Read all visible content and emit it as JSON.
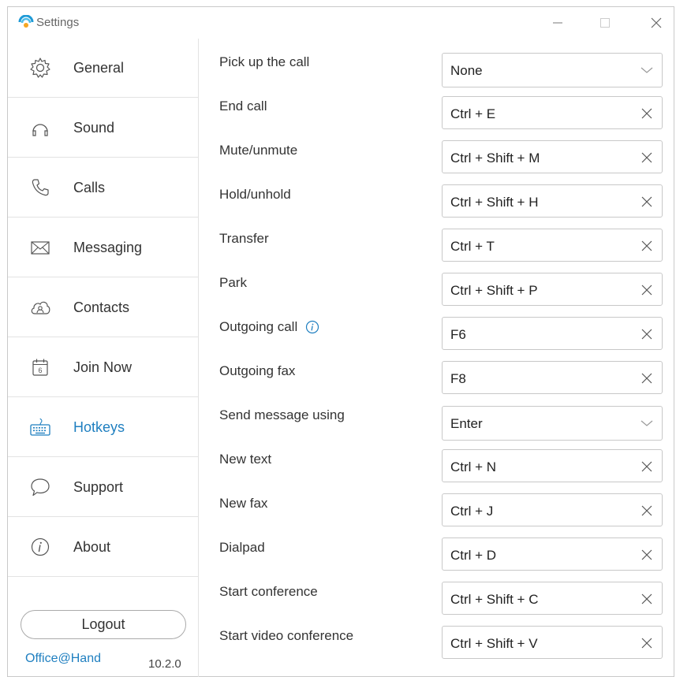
{
  "window": {
    "title": "Settings",
    "logo_icon": "office-at-hand-logo",
    "controls": {
      "minimize": "—",
      "maximize": "□",
      "close": "✕"
    }
  },
  "sidebar": {
    "items": [
      {
        "label": "General",
        "icon": "gear-icon",
        "active": false
      },
      {
        "label": "Sound",
        "icon": "headphones-icon",
        "active": false
      },
      {
        "label": "Calls",
        "icon": "phone-icon",
        "active": false
      },
      {
        "label": "Messaging",
        "icon": "envelope-icon",
        "active": false
      },
      {
        "label": "Contacts",
        "icon": "cloud-contacts-icon",
        "active": false
      },
      {
        "label": "Join Now",
        "icon": "calendar-icon",
        "active": false
      },
      {
        "label": "Hotkeys",
        "icon": "keyboard-icon",
        "active": true
      },
      {
        "label": "Support",
        "icon": "chat-bubble-icon",
        "active": false
      },
      {
        "label": "About",
        "icon": "info-icon",
        "active": false
      }
    ],
    "calendar_day": "6",
    "logout_label": "Logout",
    "brand": "Office@Hand",
    "version": "10.2.0"
  },
  "hotkeys": {
    "rows": [
      {
        "label": "Pick up the call",
        "value": "None",
        "control": "dropdown"
      },
      {
        "label": "End call",
        "value": "Ctrl + E",
        "control": "clear"
      },
      {
        "label": "Mute/unmute",
        "value": "Ctrl + Shift + M",
        "control": "clear"
      },
      {
        "label": "Hold/unhold",
        "value": "Ctrl + Shift + H",
        "control": "clear"
      },
      {
        "label": "Transfer",
        "value": "Ctrl + T",
        "control": "clear"
      },
      {
        "label": "Park",
        "value": "Ctrl + Shift + P",
        "control": "clear"
      },
      {
        "label": "Outgoing call",
        "value": "F6",
        "control": "clear",
        "info": true
      },
      {
        "label": "Outgoing fax",
        "value": "F8",
        "control": "clear"
      },
      {
        "label": "Send message using",
        "value": "Enter",
        "control": "dropdown"
      },
      {
        "label": "New text",
        "value": "Ctrl + N",
        "control": "clear"
      },
      {
        "label": "New fax",
        "value": "Ctrl + J",
        "control": "clear"
      },
      {
        "label": "Dialpad",
        "value": "Ctrl + D",
        "control": "clear"
      },
      {
        "label": "Start conference",
        "value": "Ctrl + Shift + C",
        "control": "clear"
      },
      {
        "label": "Start video conference",
        "value": "Ctrl + Shift + V",
        "control": "clear"
      }
    ]
  },
  "colors": {
    "accent": "#1f7fc0",
    "border": "#c8c8c8",
    "divider": "#e3e3e3"
  }
}
